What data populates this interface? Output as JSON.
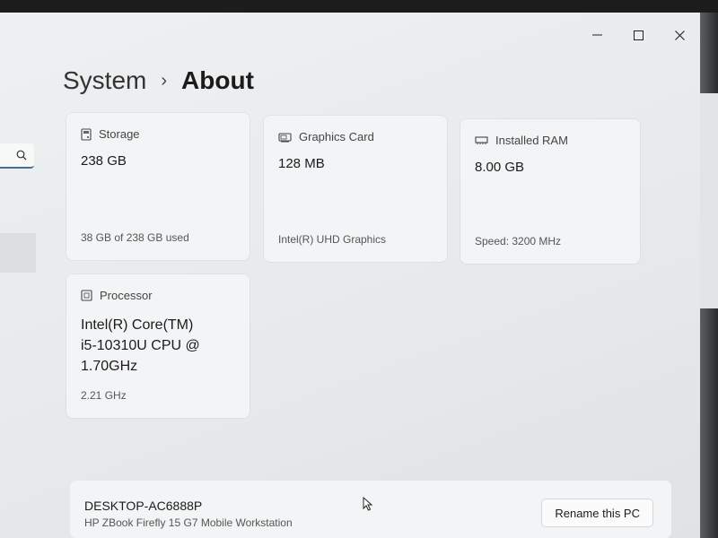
{
  "window": {
    "caption": {
      "minimize": "–",
      "maximize": "☐",
      "close": "✕"
    }
  },
  "sidebar": {
    "search_icon": "search-icon"
  },
  "breadcrumb": {
    "parent": "System",
    "separator": "›",
    "current": "About"
  },
  "specs": {
    "storage": {
      "label": "Storage",
      "value": "238 GB",
      "detail": "38 GB of 238 GB used",
      "icon": "storage-icon"
    },
    "graphics": {
      "label": "Graphics Card",
      "value": "128 MB",
      "detail": "Intel(R) UHD Graphics",
      "icon": "graphics-card-icon"
    },
    "ram": {
      "label": "Installed RAM",
      "value": "8.00 GB",
      "detail": "Speed: 3200 MHz",
      "icon": "ram-icon"
    },
    "processor": {
      "label": "Processor",
      "value_lines": [
        "Intel(R) Core(TM)",
        "i5-10310U CPU @",
        "1.70GHz"
      ],
      "detail": "2.21 GHz",
      "icon": "processor-icon"
    }
  },
  "device": {
    "name": "DESKTOP-AC6888P",
    "model": "HP ZBook Firefly 15 G7 Mobile Workstation",
    "rename_label": "Rename this PC"
  },
  "colors": {
    "background": "#e9ecee",
    "card": "#f3f4f5",
    "accent": "#4a6f8f"
  }
}
